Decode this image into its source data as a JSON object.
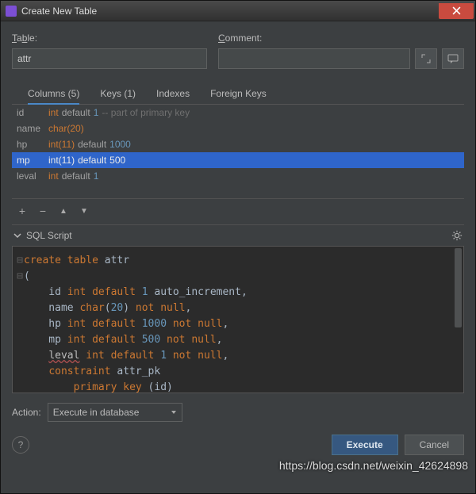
{
  "window": {
    "title": "Create New Table"
  },
  "labels": {
    "table": "Table:",
    "comment": "Comment:",
    "action": "Action:",
    "sql_script": "SQL Script"
  },
  "inputs": {
    "table_name": "attr",
    "comment": ""
  },
  "tabs": [
    {
      "label": "Columns (5)",
      "active": true
    },
    {
      "label": "Keys (1)",
      "active": false
    },
    {
      "label": "Indexes",
      "active": false
    },
    {
      "label": "Foreign Keys",
      "active": false
    }
  ],
  "columns": [
    {
      "name": "id",
      "type": "int",
      "default_kw": "default",
      "default_val": "1",
      "hint": "-- part of primary key",
      "selected": false
    },
    {
      "name": "name",
      "type": "char(20)",
      "default_kw": "",
      "default_val": "",
      "hint": "",
      "selected": false
    },
    {
      "name": "hp",
      "type": "int(11)",
      "default_kw": "default",
      "default_val": "1000",
      "hint": "",
      "selected": false
    },
    {
      "name": "mp",
      "type": "int(11)",
      "default_kw": "default",
      "default_val": "500",
      "hint": "",
      "selected": true
    },
    {
      "name": "leval",
      "type": "int",
      "default_kw": "default",
      "default_val": "1",
      "hint": "",
      "selected": false
    }
  ],
  "toolbar": {
    "add": "+",
    "remove": "−",
    "up": "▲",
    "down": "▼"
  },
  "sql": {
    "lines": [
      {
        "g": "⊟",
        "t": [
          [
            "kw",
            "create table "
          ],
          [
            "id",
            "attr"
          ]
        ]
      },
      {
        "g": "⊟",
        "t": [
          [
            "id",
            "("
          ]
        ]
      },
      {
        "g": "",
        "t": [
          [
            "id",
            "    id "
          ],
          [
            "kw",
            "int default "
          ],
          [
            "num",
            "1"
          ],
          [
            "id",
            " auto_increment,"
          ]
        ]
      },
      {
        "g": "",
        "t": [
          [
            "id",
            "    name "
          ],
          [
            "kw",
            "char"
          ],
          [
            "id",
            "("
          ],
          [
            "num",
            "20"
          ],
          [
            "id",
            ") "
          ],
          [
            "kw",
            "not null"
          ],
          [
            "id",
            ","
          ]
        ]
      },
      {
        "g": "",
        "t": [
          [
            "id",
            "    hp "
          ],
          [
            "kw",
            "int default "
          ],
          [
            "num",
            "1000"
          ],
          [
            "id",
            " "
          ],
          [
            "kw",
            "not null"
          ],
          [
            "id",
            ","
          ]
        ]
      },
      {
        "g": "",
        "t": [
          [
            "id",
            "    mp "
          ],
          [
            "kw",
            "int default "
          ],
          [
            "num",
            "500"
          ],
          [
            "id",
            " "
          ],
          [
            "kw",
            "not null"
          ],
          [
            "id",
            ","
          ]
        ]
      },
      {
        "g": "",
        "t": [
          [
            "id",
            "    "
          ],
          [
            "err",
            "leval"
          ],
          [
            "id",
            " "
          ],
          [
            "kw",
            "int default "
          ],
          [
            "num",
            "1"
          ],
          [
            "id",
            " "
          ],
          [
            "kw",
            "not null"
          ],
          [
            "id",
            ","
          ]
        ]
      },
      {
        "g": "",
        "t": [
          [
            "id",
            "    "
          ],
          [
            "kw",
            "constraint "
          ],
          [
            "id",
            "attr_pk"
          ]
        ]
      },
      {
        "g": "",
        "t": [
          [
            "id",
            "        "
          ],
          [
            "kw",
            "primary key "
          ],
          [
            "id",
            "("
          ],
          [
            "id",
            "id"
          ],
          [
            "id",
            ")"
          ]
        ]
      },
      {
        "g": "",
        "t": [
          [
            "id",
            ");"
          ]
        ]
      }
    ]
  },
  "action": {
    "selected": "Execute in database"
  },
  "buttons": {
    "execute": "Execute",
    "cancel": "Cancel",
    "help": "?"
  },
  "watermark": "https://blog.csdn.net/weixin_42624898"
}
